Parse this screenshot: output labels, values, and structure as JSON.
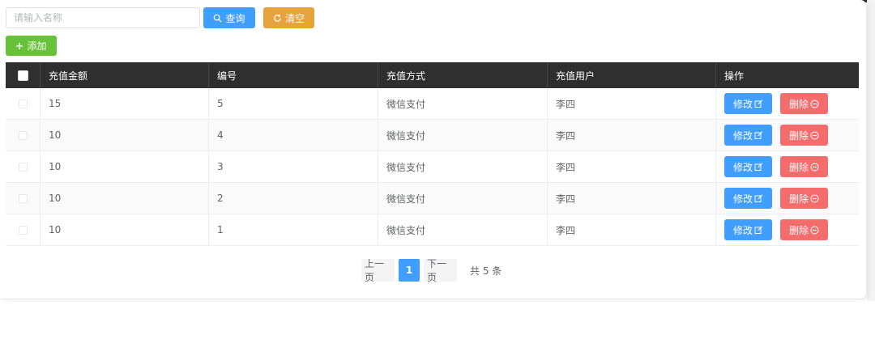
{
  "toolbar": {
    "search_placeholder": "请输入名称",
    "query_label": "查询",
    "clear_label": "清空",
    "add_label": "添加"
  },
  "table": {
    "columns": [
      "充值金额",
      "编号",
      "充值方式",
      "充值用户",
      "操作"
    ],
    "rows": [
      {
        "amount": "15",
        "id": "5",
        "method": "微信支付",
        "user": "李四"
      },
      {
        "amount": "10",
        "id": "4",
        "method": "微信支付",
        "user": "李四"
      },
      {
        "amount": "10",
        "id": "3",
        "method": "微信支付",
        "user": "李四"
      },
      {
        "amount": "10",
        "id": "2",
        "method": "微信支付",
        "user": "李四"
      },
      {
        "amount": "10",
        "id": "1",
        "method": "微信支付",
        "user": "李四"
      }
    ],
    "edit_label": "修改",
    "delete_label": "删除"
  },
  "pagination": {
    "prev_label": "上一页",
    "current_page": "1",
    "next_label": "下一页",
    "total_text": "共 5 条"
  },
  "colors": {
    "primary": "#409eff",
    "warning": "#e6a23c",
    "success": "#67c23a",
    "danger": "#f56c6c",
    "header_bg": "#2f2f2f"
  },
  "icons": {
    "query": "search-icon",
    "clear": "refresh-icon",
    "add": "plus-icon",
    "edit": "edit-icon",
    "delete": "minus-circle-icon"
  }
}
